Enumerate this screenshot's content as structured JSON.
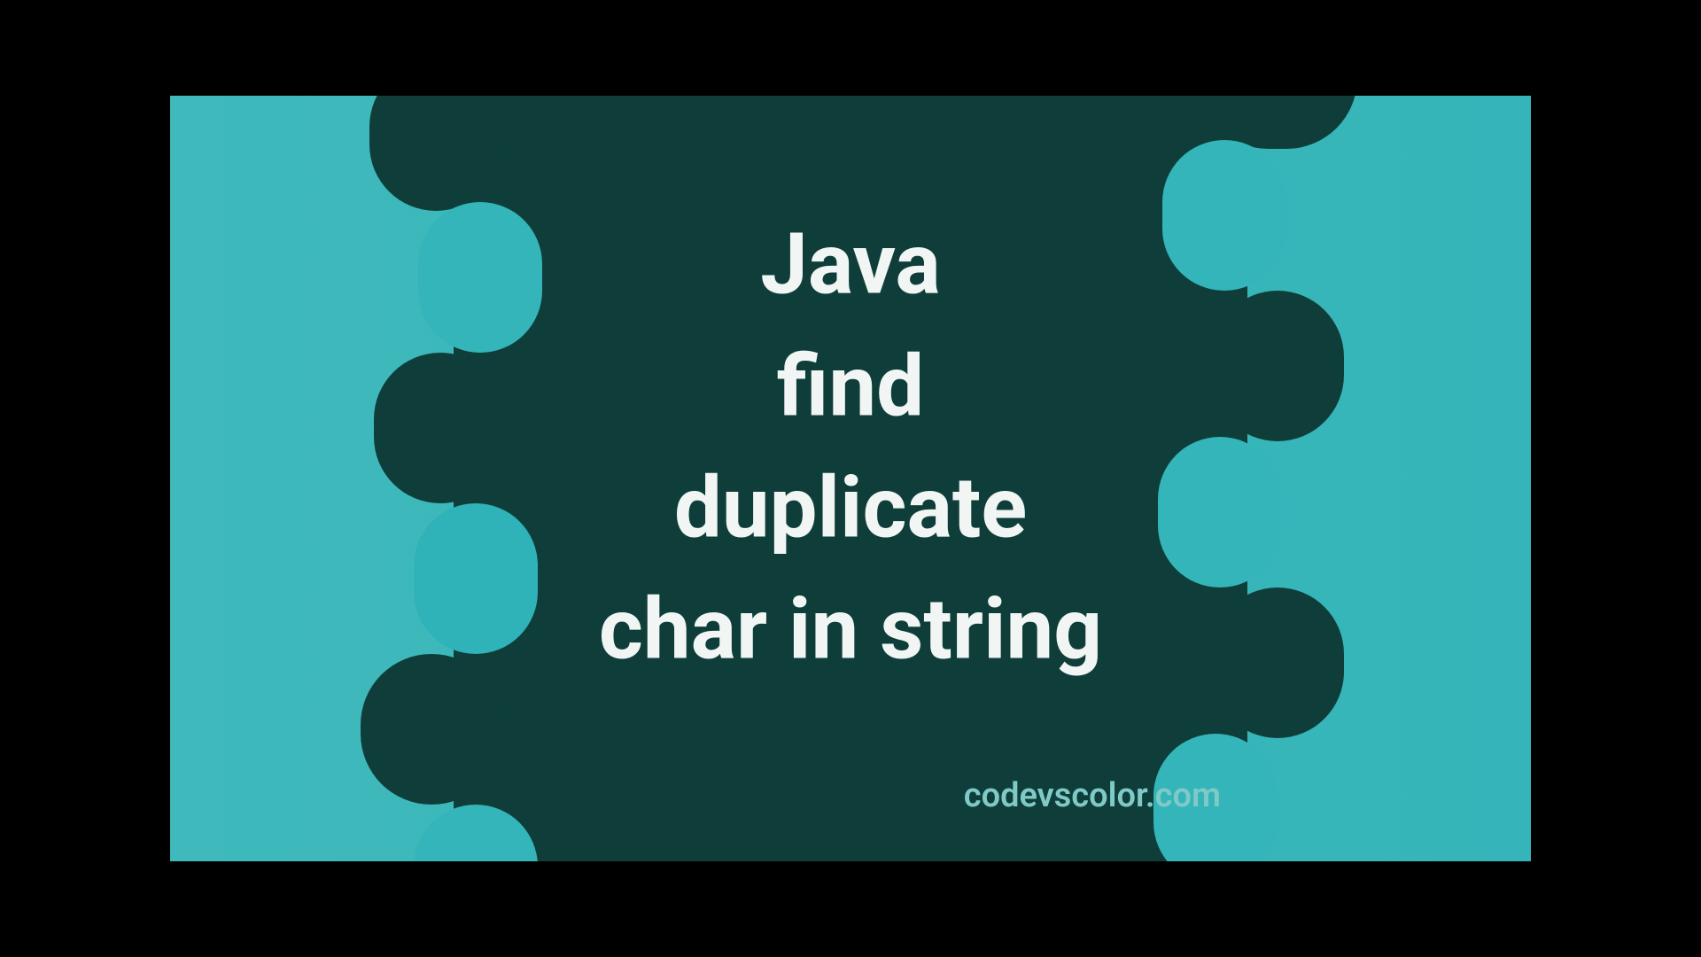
{
  "title": "Java\nfind\nduplicate\nchar in string",
  "credit": "codevscolor.com",
  "colors": {
    "background_teal": "#35b5b9",
    "blob_dark": "#0f3e3a",
    "text_white": "#f1f6f4",
    "credit_teal": "#7fc9c7"
  }
}
